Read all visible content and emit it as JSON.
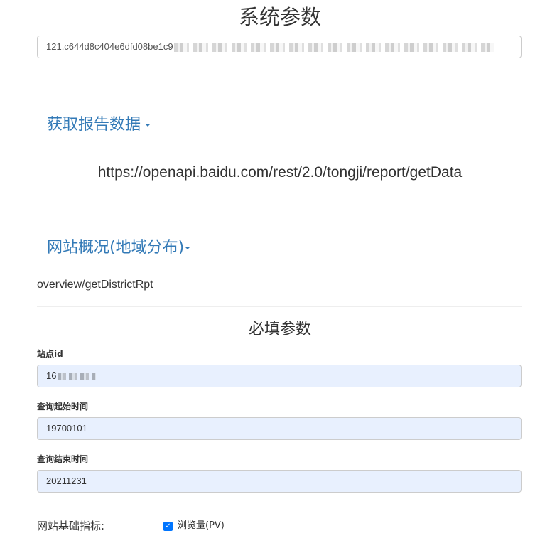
{
  "page": {
    "title": "系统参数"
  },
  "token": {
    "visible_value": "121.c644d8c404e6dfd08be1c9"
  },
  "report_menu": {
    "label": "获取报告数据"
  },
  "api": {
    "url": "https://openapi.baidu.com/rest/2.0/tongji/report/getData"
  },
  "overview_menu": {
    "label": "网站概况(地域分布)"
  },
  "method": {
    "path": "overview/getDistrictRpt"
  },
  "required_params": {
    "title": "必填参数",
    "site_id": {
      "label": "站点id",
      "visible_value": "16"
    },
    "start_date": {
      "label": "查询起始时间",
      "value": "19700101"
    },
    "end_date": {
      "label": "查询结束时间",
      "value": "20211231"
    }
  },
  "metrics": {
    "label": "网站基础指标:",
    "options": [
      {
        "label": "浏览量(PV)",
        "checked": true
      }
    ]
  },
  "colors": {
    "link": "#337ab7",
    "autofill_background": "#e8f0fe",
    "checkbox": "#0075ff"
  },
  "icons": {
    "dropdown": "caret-down-icon",
    "checkbox": "check-icon"
  }
}
